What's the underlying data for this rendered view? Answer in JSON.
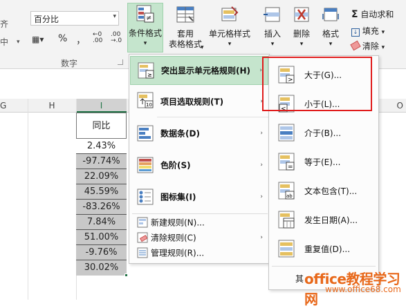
{
  "ribbon": {
    "number_format": "百分比",
    "format_buttons": [
      "%",
      "，"
    ],
    "number_group_label": "数字",
    "left_label": "中",
    "left_label2": "齐",
    "conditional_format": "条件格式",
    "table_format_1": "套用",
    "table_format_2": "表格格式",
    "cell_style": "单元格样式",
    "insert": "插入",
    "delete": "删除",
    "format": "格式",
    "autosum": "自动求和",
    "fill": "填充",
    "clear": "清除",
    "accent": "#c5e5cd"
  },
  "sheet": {
    "col_headers": [
      "G",
      "H",
      "I"
    ],
    "col_header_right": "O",
    "header_cell": "同比",
    "values": [
      "2.43%",
      "-97.74%",
      "22.09%",
      "45.59%",
      "-83.26%",
      "7.84%",
      "51.00%",
      "-9.76%",
      "30.02%"
    ]
  },
  "menu": {
    "items": [
      {
        "label": "突出显示单元格规则(H)",
        "sub": "›"
      },
      {
        "label": "项目选取规则(T)",
        "sub": "›"
      },
      {
        "label": "数据条(D)",
        "sub": "›"
      },
      {
        "label": "色阶(S)",
        "sub": "›"
      },
      {
        "label": "图标集(I)",
        "sub": "›"
      }
    ],
    "small": [
      {
        "label": "新建规则(N)..."
      },
      {
        "label": "清除规则(C)",
        "sub": "›"
      },
      {
        "label": "管理规则(R)..."
      }
    ]
  },
  "submenu": {
    "items": [
      {
        "label": "大于(G)..."
      },
      {
        "label": "小于(L)..."
      },
      {
        "label": "介于(B)..."
      },
      {
        "label": "等于(E)..."
      },
      {
        "label": "文本包含(T)..."
      },
      {
        "label": "发生日期(A)..."
      },
      {
        "label": "重复值(D)..."
      }
    ],
    "more": "其"
  },
  "watermark": {
    "main": "office教程学习网",
    "sub": "www.office68.com"
  }
}
